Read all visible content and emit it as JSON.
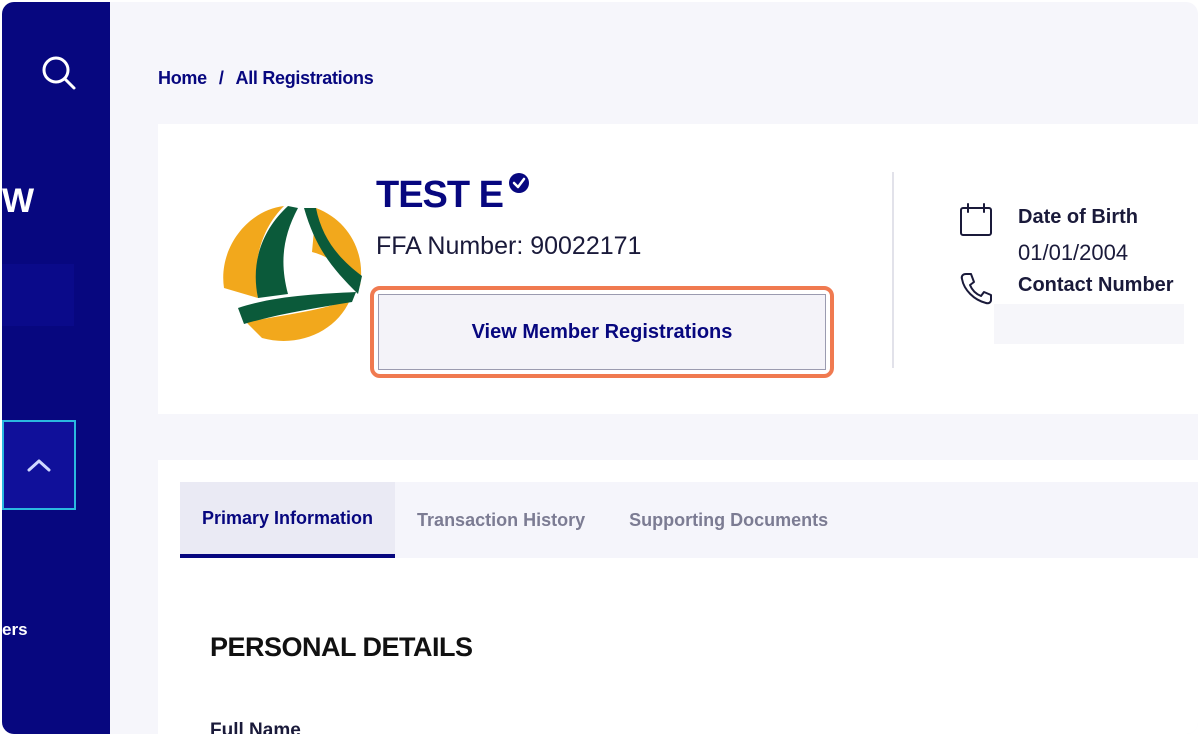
{
  "breadcrumb": {
    "home": "Home",
    "separator": "/",
    "current": "All Registrations"
  },
  "sidebar": {
    "partial_heading": "W",
    "partial_item": "ers"
  },
  "member": {
    "name": "TEST E",
    "ffa_number": "FFA Number: 90022171",
    "view_button": "View Member Registrations",
    "dob_label": "Date of Birth",
    "dob_value": "01/01/2004",
    "contact_label": "Contact Number",
    "contact_value": ""
  },
  "tabs": [
    {
      "label": "Primary Information",
      "active": true
    },
    {
      "label": "Transaction History",
      "active": false
    },
    {
      "label": "Supporting Documents",
      "active": false
    }
  ],
  "section": {
    "title": "PERSONAL DETAILS",
    "first_field": "Full Name"
  },
  "colors": {
    "brand_navy": "#07077f",
    "highlight": "#f07a50",
    "toggle_border": "#2ab9e0",
    "logo_green": "#0b5a3a",
    "logo_gold": "#f2a81c"
  },
  "icons": {
    "search": "search-icon",
    "verified": "verified-badge-icon",
    "calendar": "calendar-icon",
    "phone": "phone-icon",
    "chevron": "chevron-up-icon"
  }
}
